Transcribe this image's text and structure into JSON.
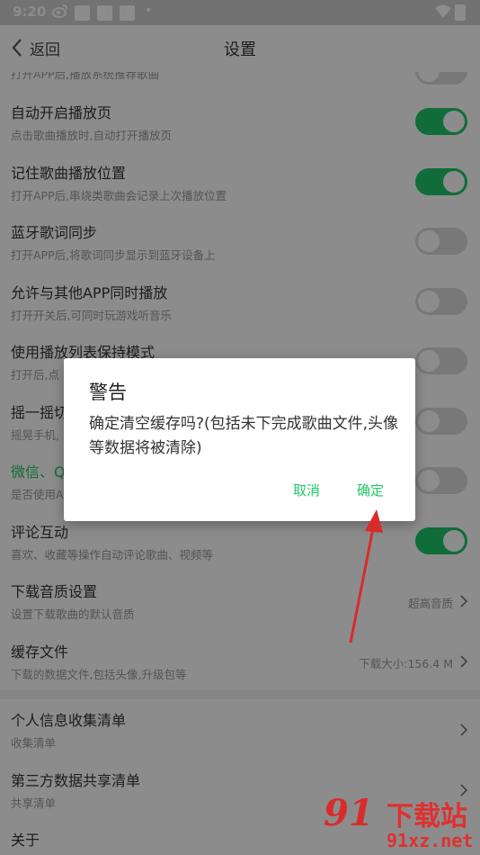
{
  "status_bar": {
    "time": "9:20",
    "weibo_icon": "weibo-icon",
    "dot": "•"
  },
  "header": {
    "back_label": "返回",
    "title": "设置"
  },
  "partial_row": {
    "subtitle": "打开APP后,播放系统推荐歌曲"
  },
  "settings": [
    {
      "title": "自动开启播放页",
      "subtitle": "点击歌曲播放时,自动打开播放页",
      "toggle": "on"
    },
    {
      "title": "记住歌曲播放位置",
      "subtitle": "打开APP后,串烧类歌曲会记录上次播放位置",
      "toggle": "on"
    },
    {
      "title": "蓝牙歌词同步",
      "subtitle": "打开APP后,将歌词同步显示到蓝牙设备上",
      "toggle": "off"
    },
    {
      "title": "允许与其他APP同时播放",
      "subtitle": "打开开关后,可同时玩游戏听音乐",
      "toggle": "off"
    },
    {
      "title": "使用播放列表保持模式",
      "subtitle": "打开后,点",
      "toggle": "off"
    },
    {
      "title": "摇一摇切",
      "subtitle": "摇晃手机,",
      "toggle": "off"
    },
    {
      "title": "微信、Q",
      "subtitle": "是否使用A",
      "toggle": "off"
    },
    {
      "title": "评论互动",
      "subtitle": "喜欢、收藏等操作自动评论歌曲、视频等",
      "toggle": "on"
    }
  ],
  "download_quality": {
    "title": "下载音质设置",
    "subtitle": "设置下载歌曲的默认音质",
    "value": "超高音质"
  },
  "cache_files": {
    "title": "缓存文件",
    "subtitle": "下载的数据文件,包括头像,升级包等",
    "value": "下载大小:156.4 M"
  },
  "privacy": [
    {
      "title": "个人信息收集清单",
      "subtitle": "收集清单"
    },
    {
      "title": "第三方数据共享清单",
      "subtitle": "共享清单"
    }
  ],
  "about": {
    "title": "关于"
  },
  "dialog": {
    "title": "警告",
    "message": "确定清空缓存吗?(包括未下完成歌曲文件,头像等数据将被清除)",
    "cancel_label": "取消",
    "ok_label": "确定"
  },
  "watermark": {
    "logo": "91",
    "site_name": "下载站",
    "url": "91xz.net"
  },
  "colors": {
    "accent": "#1ec66a",
    "annotation": "#d92b2b"
  }
}
